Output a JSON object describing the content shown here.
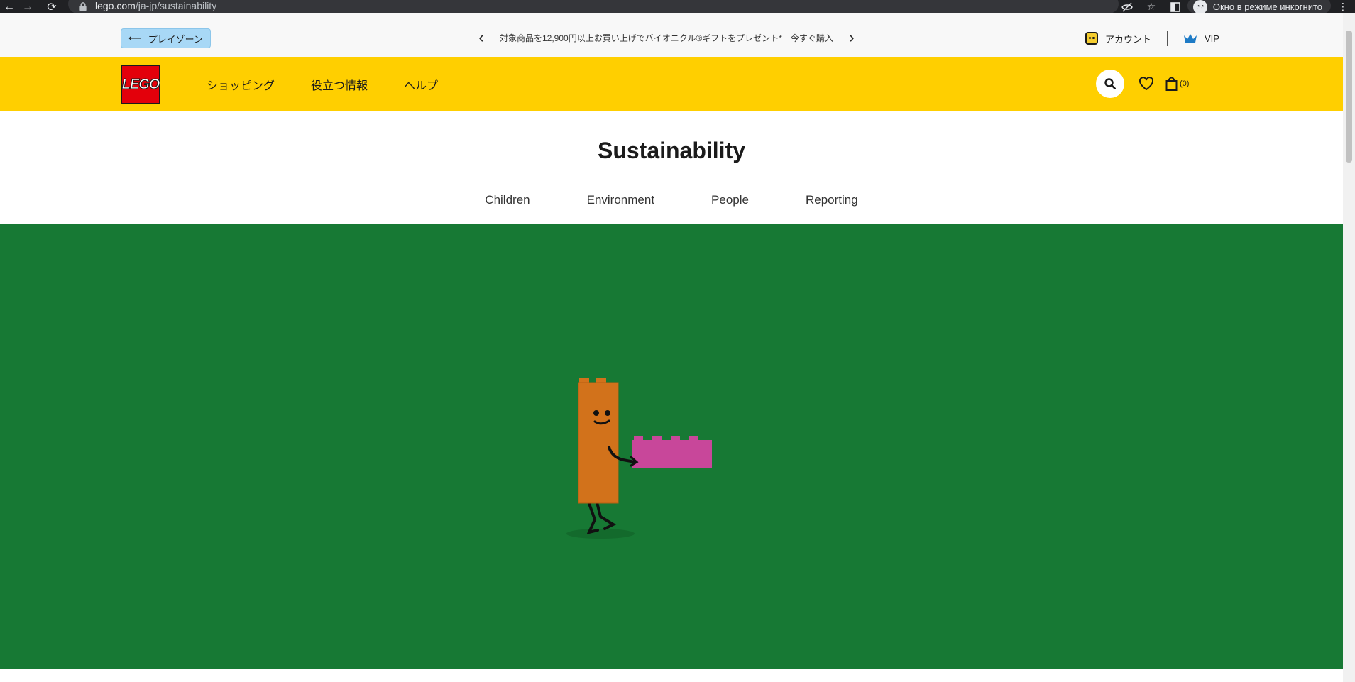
{
  "browser": {
    "url_host": "lego.com",
    "url_path": "/ja-jp/sustainability",
    "profile_label": "Окно в режиме инкогнито"
  },
  "utility_bar": {
    "back_label": "プレイゾーン",
    "promo_text": "対象商品を12,900円以上お買い上げでバイオニクル®ギフトをプレゼント*　今すぐ購入",
    "account_label": "アカウント",
    "vip_label": "VIP"
  },
  "header": {
    "logo_text": "LEGO",
    "nav": [
      "ショッピング",
      "役立つ情報",
      "ヘルプ"
    ],
    "bag_count": "(0)"
  },
  "page": {
    "title": "Sustainability",
    "subnav": [
      "Children",
      "Environment",
      "People",
      "Reporting"
    ]
  },
  "colors": {
    "header_yellow": "#ffcf00",
    "hero_green": "#177934",
    "logo_red": "#e3000b",
    "brick_orange": "#d2721b",
    "brick_pink": "#c8479a"
  }
}
